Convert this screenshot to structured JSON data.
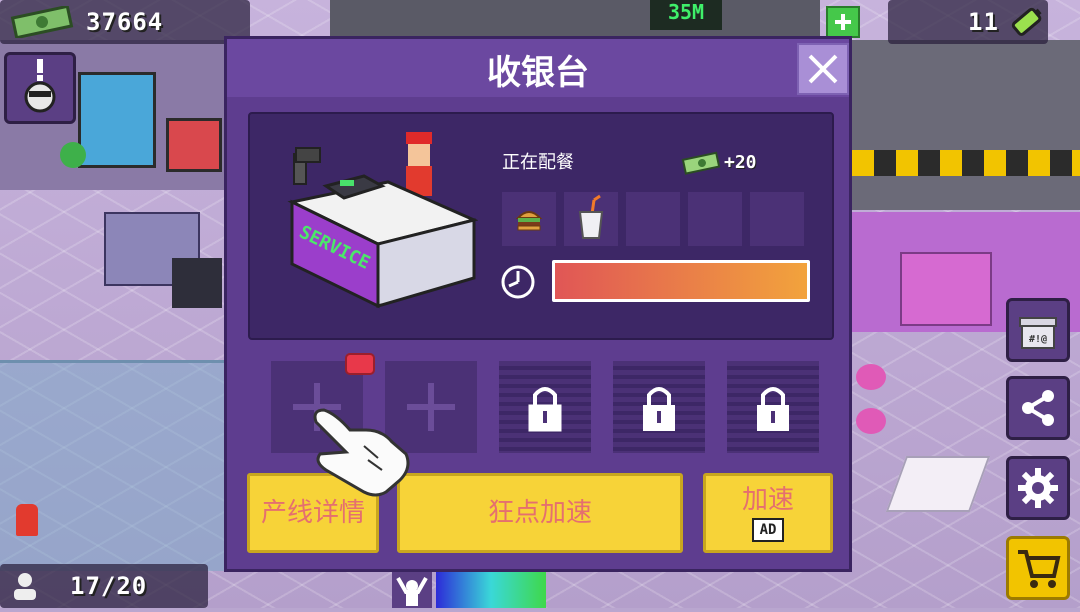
{
  "hud": {
    "money": "37664",
    "energy": "11",
    "staff_count": "17/20"
  },
  "modal": {
    "title": "收银台",
    "station_label": "SERVICE",
    "status_text": "正在配餐",
    "reward_text": "+20",
    "order_items": [
      "burger-icon",
      "drink-cup-icon",
      "",
      "",
      ""
    ],
    "progress": 1.0,
    "progress_colors": {
      "start": "#e05656",
      "end": "#f2a33c"
    },
    "line_slots": [
      {
        "state": "add",
        "icon": "plus-icon",
        "has_badge": true
      },
      {
        "state": "add",
        "icon": "plus-icon",
        "has_badge": false
      },
      {
        "state": "locked",
        "icon": "lock-icon"
      },
      {
        "state": "locked",
        "icon": "lock-icon"
      },
      {
        "state": "locked",
        "icon": "lock-icon"
      }
    ],
    "buttons": {
      "line_details": "产线详情",
      "tap_speedup": "狂点加速",
      "ad_speedup": "加速",
      "ad_badge": "AD"
    }
  },
  "sidebar": [
    "gift-icon",
    "share-icon",
    "gear-icon",
    "cart-icon"
  ],
  "colors": {
    "modal_bg": "#5e3d8f",
    "panel_bg": "#3d2766",
    "button_yellow": "#f7d338",
    "button_text": "#e56f6f"
  }
}
